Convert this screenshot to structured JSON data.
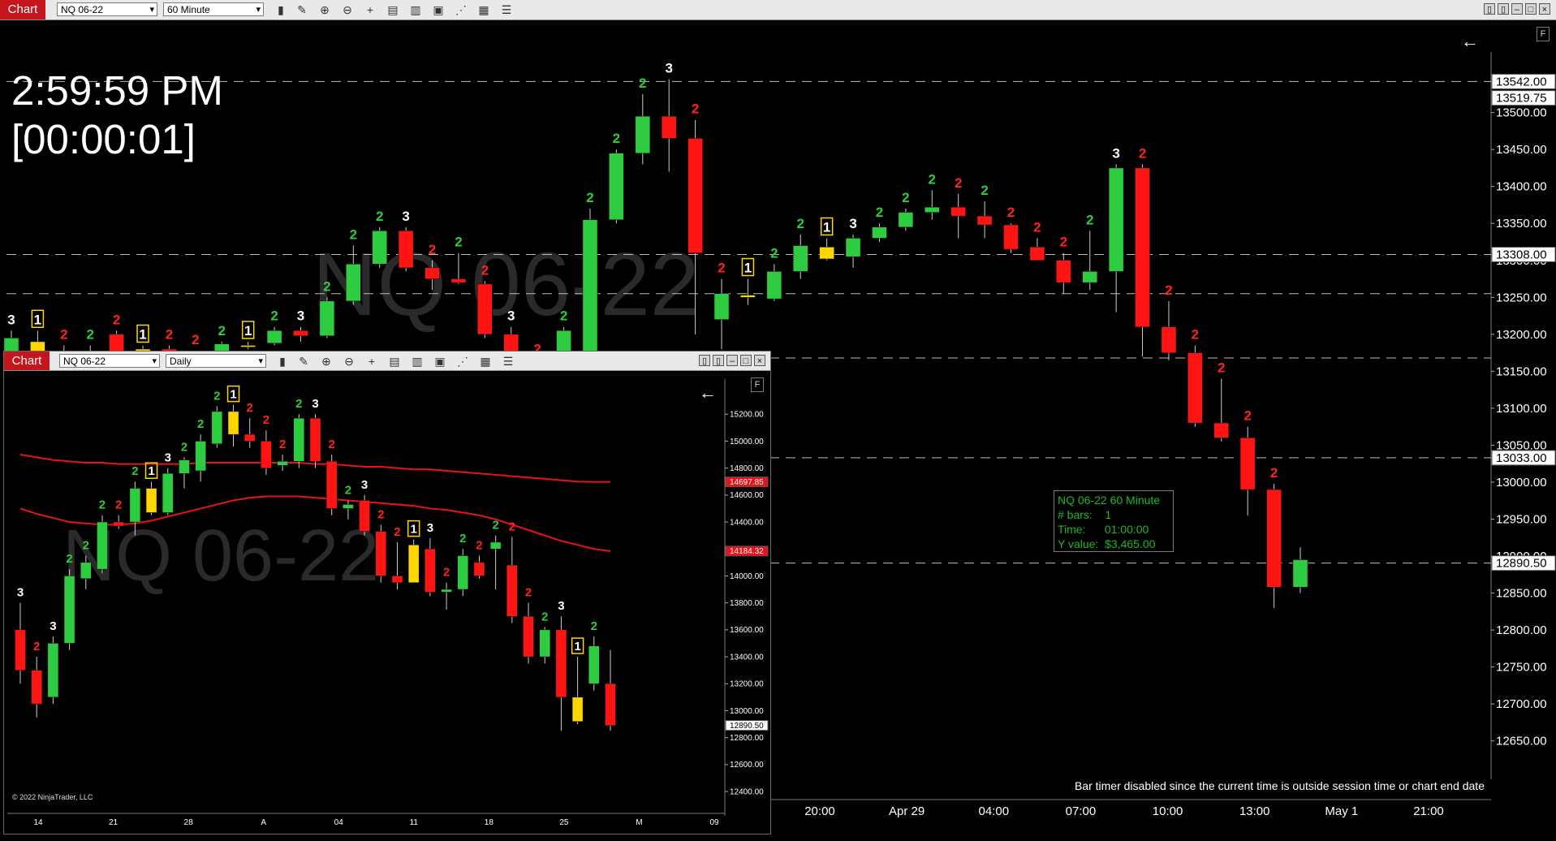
{
  "main": {
    "chart_label": "Chart",
    "instrument": "NQ 06-22",
    "interval": "60 Minute",
    "clock": "2:59:59 PM",
    "bar_countdown": "[00:00:01]",
    "watermark": "NQ 06-22",
    "price_axis": [
      "13500.00",
      "13450.00",
      "13400.00",
      "13350.00",
      "13300.00",
      "13250.00",
      "13200.00",
      "13150.00",
      "13100.00",
      "13050.00",
      "13000.00",
      "12950.00",
      "12900.00",
      "12850.00",
      "12800.00",
      "12750.00",
      "12700.00",
      "12650.00"
    ],
    "price_tags": [
      {
        "value": "13542.00",
        "color": "#ffffff",
        "text": "#000000"
      },
      {
        "value": "13519.75",
        "color": "#ffffff",
        "text": "#000000"
      },
      {
        "value": "13308.00",
        "color": "#ffffff",
        "text": "#000000"
      },
      {
        "value": "13033.00",
        "color": "#ffffff",
        "text": "#000000"
      },
      {
        "value": "12890.50",
        "color": "#ffffff",
        "text": "#000000"
      }
    ],
    "time_axis": [
      "20:00",
      "Apr 29",
      "04:00",
      "07:00",
      "10:00",
      "13:00",
      "May 1",
      "21:00"
    ],
    "tooltip": {
      "line1": "NQ 06-22 60 Minute",
      "line2": "# bars:    1",
      "line3": "Time:      01:00:00",
      "line4": "Y value:  $3,465.00"
    },
    "status_message": "Bar timer disabled since the current time is outside session time or chart end date",
    "f_button": "F",
    "back_arrow": "←"
  },
  "sub": {
    "chart_label": "Chart",
    "instrument": "NQ 06-22",
    "interval": "Daily",
    "watermark": "NQ 06-22",
    "price_axis": [
      "15200.00",
      "15000.00",
      "14800.00",
      "14600.00",
      "14400.00",
      "14200.00",
      "14000.00",
      "13800.00",
      "13600.00",
      "13400.00",
      "13200.00",
      "13000.00",
      "12800.00",
      "12600.00",
      "12400.00"
    ],
    "price_tags": [
      {
        "value": "14697.85",
        "color": "#e8121a",
        "text": "#ffffff"
      },
      {
        "value": "14184.32",
        "color": "#e8121a",
        "text": "#ffffff"
      },
      {
        "value": "12890.50",
        "color": "#ffffff",
        "text": "#000000"
      }
    ],
    "time_axis": [
      "14",
      "21",
      "28",
      "A",
      "04",
      "11",
      "18",
      "25",
      "M",
      "09"
    ],
    "copyright": "© 2022 NinjaTrader, LLC",
    "f_button": "F",
    "back_arrow": "←"
  },
  "colors": {
    "up": "#2ecc40",
    "down": "#ff1414",
    "inside": "#ffd700",
    "count_green": "#2ecc40",
    "count_red": "#ff2222",
    "count_white": "#ffffff"
  },
  "chart_data": [
    {
      "type": "candlestick",
      "title": "NQ 06-22",
      "interval": "60 Minute",
      "ylim": [
        12620,
        13560
      ],
      "candles": [
        {
          "o": 13160,
          "h": 13205,
          "l": 13150,
          "c": 13195,
          "label": "3",
          "lc": "w"
        },
        {
          "o": 13190,
          "h": 13205,
          "l": 13170,
          "c": 13175,
          "label": "1",
          "lc": "y",
          "inside": true
        },
        {
          "o": 13175,
          "h": 13185,
          "l": 13150,
          "c": 13160,
          "label": "2",
          "lc": "r"
        },
        {
          "o": 13160,
          "h": 13185,
          "l": 13150,
          "c": 13175,
          "label": "2",
          "lc": "g"
        },
        {
          "o": 13200,
          "h": 13205,
          "l": 13170,
          "c": 13175,
          "label": "2",
          "lc": "r"
        },
        {
          "o": 13175,
          "h": 13185,
          "l": 13170,
          "c": 13180,
          "label": "1",
          "lc": "y",
          "inside": true
        },
        {
          "o": 13180,
          "h": 13185,
          "l": 13170,
          "c": 13172,
          "label": "2",
          "lc": "r"
        },
        {
          "o": 13172,
          "h": 13178,
          "l": 13160,
          "c": 13165,
          "label": "2",
          "lc": "r"
        },
        {
          "o": 13165,
          "h": 13190,
          "l": 13160,
          "c": 13187,
          "label": "2",
          "lc": "g"
        },
        {
          "o": 13185,
          "h": 13190,
          "l": 13180,
          "c": 13185,
          "label": "1",
          "lc": "y",
          "inside": true
        },
        {
          "o": 13188,
          "h": 13210,
          "l": 13185,
          "c": 13205,
          "label": "2",
          "lc": "g"
        },
        {
          "o": 13205,
          "h": 13210,
          "l": 13190,
          "c": 13198,
          "label": "3",
          "lc": "w"
        },
        {
          "o": 13198,
          "h": 13250,
          "l": 13195,
          "c": 13245,
          "label": "2",
          "lc": "g"
        },
        {
          "o": 13245,
          "h": 13320,
          "l": 13240,
          "c": 13295,
          "label": "2",
          "lc": "g"
        },
        {
          "o": 13295,
          "h": 13345,
          "l": 13290,
          "c": 13340,
          "label": "2",
          "lc": "g"
        },
        {
          "o": 13340,
          "h": 13345,
          "l": 13285,
          "c": 13290,
          "label": "3",
          "lc": "w"
        },
        {
          "o": 13290,
          "h": 13300,
          "l": 13260,
          "c": 13275,
          "label": "2",
          "lc": "r"
        },
        {
          "o": 13275,
          "h": 13310,
          "l": 13268,
          "c": 13270,
          "label": "2",
          "lc": "g"
        },
        {
          "o": 13268,
          "h": 13272,
          "l": 13195,
          "c": 13200,
          "label": "2",
          "lc": "r"
        },
        {
          "o": 13200,
          "h": 13210,
          "l": 13150,
          "c": 13155,
          "label": "3",
          "lc": "w"
        },
        {
          "o": 13155,
          "h": 13165,
          "l": 13140,
          "c": 13150,
          "label": "2",
          "lc": "r"
        },
        {
          "o": 13150,
          "h": 13210,
          "l": 13145,
          "c": 13205,
          "label": "2",
          "lc": "g"
        },
        {
          "o": 13150,
          "h": 13370,
          "l": 13145,
          "c": 13355,
          "label": "2",
          "lc": "g"
        },
        {
          "o": 13355,
          "h": 13450,
          "l": 13350,
          "c": 13445,
          "label": "2",
          "lc": "g"
        },
        {
          "o": 13445,
          "h": 13525,
          "l": 13430,
          "c": 13495,
          "label": "2",
          "lc": "g"
        },
        {
          "o": 13495,
          "h": 13545,
          "l": 13420,
          "c": 13465,
          "label": "3",
          "lc": "w"
        },
        {
          "o": 13465,
          "h": 13490,
          "l": 13200,
          "c": 13310,
          "label": "2",
          "lc": "r"
        },
        {
          "o": 13220,
          "h": 13275,
          "l": 13180,
          "c": 13255,
          "label": "2",
          "lc": "r"
        },
        {
          "o": 13250,
          "h": 13275,
          "l": 13240,
          "c": 13253,
          "label": "1",
          "lc": "y",
          "inside": true
        },
        {
          "o": 13248,
          "h": 13295,
          "l": 13245,
          "c": 13285,
          "label": "2",
          "lc": "g"
        },
        {
          "o": 13285,
          "h": 13335,
          "l": 13275,
          "c": 13320,
          "label": "2",
          "lc": "g"
        },
        {
          "o": 13318,
          "h": 13330,
          "l": 13300,
          "c": 13302,
          "label": "1",
          "lc": "y",
          "inside": true
        },
        {
          "o": 13305,
          "h": 13335,
          "l": 13290,
          "c": 13330,
          "label": "3",
          "lc": "w"
        },
        {
          "o": 13330,
          "h": 13350,
          "l": 13325,
          "c": 13345,
          "label": "2",
          "lc": "g"
        },
        {
          "o": 13345,
          "h": 13370,
          "l": 13340,
          "c": 13365,
          "label": "2",
          "lc": "g"
        },
        {
          "o": 13365,
          "h": 13395,
          "l": 13355,
          "c": 13372,
          "label": "2",
          "lc": "g"
        },
        {
          "o": 13372,
          "h": 13390,
          "l": 13330,
          "c": 13360,
          "label": "2",
          "lc": "r"
        },
        {
          "o": 13360,
          "h": 13380,
          "l": 13330,
          "c": 13348,
          "label": "2",
          "lc": "g"
        },
        {
          "o": 13348,
          "h": 13350,
          "l": 13310,
          "c": 13315,
          "label": "2",
          "lc": "r"
        },
        {
          "o": 13318,
          "h": 13330,
          "l": 13300,
          "c": 13300,
          "label": "2",
          "lc": "r"
        },
        {
          "o": 13300,
          "h": 13310,
          "l": 13255,
          "c": 13270,
          "label": "2",
          "lc": "r"
        },
        {
          "o": 13270,
          "h": 13340,
          "l": 13260,
          "c": 13285,
          "label": "2",
          "lc": "g"
        },
        {
          "o": 13285,
          "h": 13430,
          "l": 13230,
          "c": 13425,
          "label": "3",
          "lc": "w"
        },
        {
          "o": 13425,
          "h": 13430,
          "l": 13170,
          "c": 13210,
          "label": "2",
          "lc": "r"
        },
        {
          "o": 13210,
          "h": 13245,
          "l": 13165,
          "c": 13175,
          "label": "2",
          "lc": "r"
        },
        {
          "o": 13175,
          "h": 13185,
          "l": 13075,
          "c": 13080,
          "label": "2",
          "lc": "r"
        },
        {
          "o": 13080,
          "h": 13140,
          "l": 13055,
          "c": 13060,
          "label": "2",
          "lc": "r"
        },
        {
          "o": 13060,
          "h": 13075,
          "l": 12955,
          "c": 12990,
          "label": "2",
          "lc": "r"
        },
        {
          "o": 12990,
          "h": 12998,
          "l": 12830,
          "c": 12858,
          "label": "2",
          "lc": "r"
        },
        {
          "o": 12858,
          "h": 12912,
          "l": 12850,
          "c": 12895,
          "label": "",
          "lc": "g"
        }
      ],
      "reference_lines": [
        13542.0,
        13308.0,
        13033.0,
        13255.0,
        13168.0,
        12890.5
      ]
    },
    {
      "type": "candlestick",
      "title": "NQ 06-22",
      "interval": "Daily",
      "ylim": [
        12340,
        15340
      ],
      "candles": [
        {
          "o": 13600,
          "h": 13800,
          "l": 13200,
          "c": 13300,
          "label": "3",
          "lc": "w"
        },
        {
          "o": 13300,
          "h": 13400,
          "l": 12950,
          "c": 13050,
          "label": "2",
          "lc": "r"
        },
        {
          "o": 13100,
          "h": 13550,
          "l": 13050,
          "c": 13500,
          "label": "3",
          "lc": "w"
        },
        {
          "o": 13500,
          "h": 14050,
          "l": 13450,
          "c": 14000,
          "label": "2",
          "lc": "g"
        },
        {
          "o": 13980,
          "h": 14150,
          "l": 13900,
          "c": 14100,
          "label": "2",
          "lc": "g"
        },
        {
          "o": 14050,
          "h": 14450,
          "l": 14020,
          "c": 14400,
          "label": "2",
          "lc": "g"
        },
        {
          "o": 14400,
          "h": 14450,
          "l": 14350,
          "c": 14370,
          "label": "2",
          "lc": "r"
        },
        {
          "o": 14400,
          "h": 14700,
          "l": 14300,
          "c": 14650,
          "label": "2",
          "lc": "g"
        },
        {
          "o": 14650,
          "h": 14700,
          "l": 14450,
          "c": 14470,
          "label": "1",
          "lc": "y",
          "inside": true
        },
        {
          "o": 14470,
          "h": 14800,
          "l": 14450,
          "c": 14760,
          "label": "3",
          "lc": "w"
        },
        {
          "o": 14760,
          "h": 14880,
          "l": 14650,
          "c": 14860,
          "label": "2",
          "lc": "g"
        },
        {
          "o": 14780,
          "h": 15050,
          "l": 14700,
          "c": 15000,
          "label": "2",
          "lc": "g"
        },
        {
          "o": 14980,
          "h": 15260,
          "l": 14950,
          "c": 15220,
          "label": "2",
          "lc": "g"
        },
        {
          "o": 15220,
          "h": 15270,
          "l": 14960,
          "c": 15050,
          "label": "1",
          "lc": "y",
          "inside": true
        },
        {
          "o": 15050,
          "h": 15170,
          "l": 14950,
          "c": 15000,
          "label": "2",
          "lc": "r"
        },
        {
          "o": 15000,
          "h": 15080,
          "l": 14750,
          "c": 14800,
          "label": "2",
          "lc": "r"
        },
        {
          "o": 14820,
          "h": 14900,
          "l": 14780,
          "c": 14850,
          "label": "2",
          "lc": "r"
        },
        {
          "o": 14850,
          "h": 15200,
          "l": 14800,
          "c": 15170,
          "label": "2",
          "lc": "g"
        },
        {
          "o": 15170,
          "h": 15200,
          "l": 14800,
          "c": 14850,
          "label": "3",
          "lc": "w"
        },
        {
          "o": 14850,
          "h": 14900,
          "l": 14450,
          "c": 14500,
          "label": "2",
          "lc": "r"
        },
        {
          "o": 14500,
          "h": 14560,
          "l": 14420,
          "c": 14530,
          "label": "2",
          "lc": "g"
        },
        {
          "o": 14560,
          "h": 14600,
          "l": 14300,
          "c": 14330,
          "label": "3",
          "lc": "w"
        },
        {
          "o": 14330,
          "h": 14380,
          "l": 13950,
          "c": 14000,
          "label": "2",
          "lc": "r"
        },
        {
          "o": 14000,
          "h": 14250,
          "l": 13900,
          "c": 13950,
          "label": "2",
          "lc": "r"
        },
        {
          "o": 14230,
          "h": 14270,
          "l": 13950,
          "c": 13950,
          "label": "1",
          "lc": "y",
          "inside": true
        },
        {
          "o": 14200,
          "h": 14280,
          "l": 13850,
          "c": 13880,
          "label": "3",
          "lc": "w"
        },
        {
          "o": 13880,
          "h": 13950,
          "l": 13750,
          "c": 13900,
          "label": "2",
          "lc": "r"
        },
        {
          "o": 13900,
          "h": 14200,
          "l": 13850,
          "c": 14150,
          "label": "2",
          "lc": "g"
        },
        {
          "o": 14100,
          "h": 14150,
          "l": 13980,
          "c": 14000,
          "label": "2",
          "lc": "r"
        },
        {
          "o": 14200,
          "h": 14300,
          "l": 13900,
          "c": 14250,
          "label": "2",
          "lc": "g"
        },
        {
          "o": 14080,
          "h": 14290,
          "l": 13650,
          "c": 13700,
          "label": "2",
          "lc": "r"
        },
        {
          "o": 13700,
          "h": 13800,
          "l": 13350,
          "c": 13400,
          "label": "2",
          "lc": "r"
        },
        {
          "o": 13400,
          "h": 13620,
          "l": 13350,
          "c": 13600,
          "label": "2",
          "lc": "g"
        },
        {
          "o": 13600,
          "h": 13700,
          "l": 12850,
          "c": 13100,
          "label": "3",
          "lc": "w"
        },
        {
          "o": 13100,
          "h": 13400,
          "l": 12900,
          "c": 12920,
          "label": "1",
          "lc": "y",
          "inside": true
        },
        {
          "o": 13200,
          "h": 13550,
          "l": 13150,
          "c": 13480,
          "label": "2",
          "lc": "g"
        },
        {
          "o": 13200,
          "h": 13450,
          "l": 12850,
          "c": 12890,
          "label": "",
          "lc": "r"
        }
      ],
      "moving_averages": [
        {
          "color": "#e8121a",
          "values": [
            14900,
            14880,
            14860,
            14850,
            14840,
            14840,
            14830,
            14830,
            14830,
            14830,
            14830,
            14840,
            14840,
            14840,
            14840,
            14840,
            14840,
            14840,
            14830,
            14830,
            14820,
            14810,
            14810,
            14800,
            14790,
            14790,
            14780,
            14770,
            14760,
            14750,
            14740,
            14730,
            14720,
            14710,
            14700,
            14697.85,
            14697.85
          ]
        },
        {
          "color": "#e8121a",
          "values": [
            14500,
            14460,
            14430,
            14400,
            14390,
            14380,
            14380,
            14390,
            14410,
            14440,
            14470,
            14500,
            14530,
            14560,
            14580,
            14590,
            14590,
            14590,
            14580,
            14570,
            14560,
            14550,
            14540,
            14530,
            14520,
            14500,
            14490,
            14470,
            14450,
            14420,
            14380,
            14340,
            14300,
            14260,
            14230,
            14200,
            14184.32
          ]
        }
      ]
    }
  ]
}
